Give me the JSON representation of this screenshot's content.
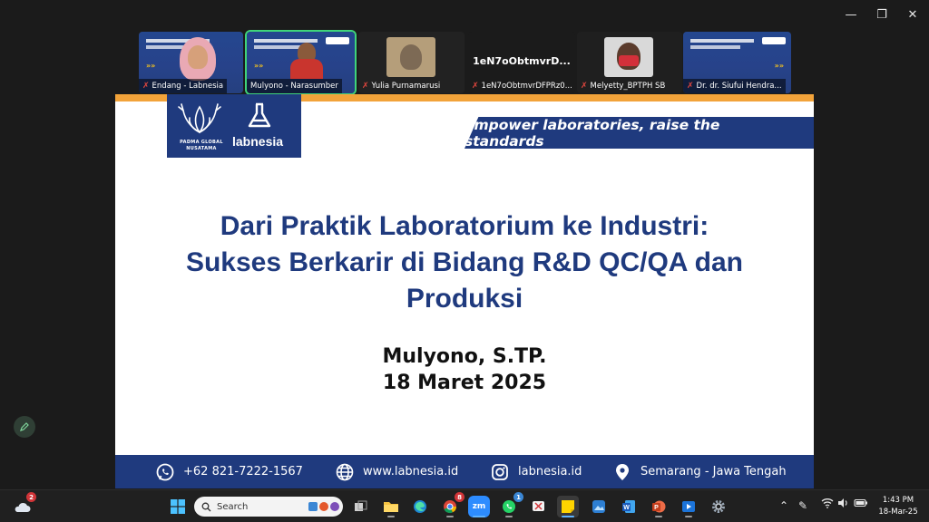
{
  "window": {
    "minimize_icon": "minimize-icon",
    "restore_icon": "restore-icon",
    "close_icon": "close-icon"
  },
  "participants": [
    {
      "name": "Endang - Labnesia",
      "muted": true
    },
    {
      "name": "Mulyono - Narasumber",
      "muted": false
    },
    {
      "name": "Yulia Purnamarusi",
      "muted": true
    },
    {
      "name": "1eN7oObtmvrDFPRz0...",
      "label": "1eN7oObtmvrD...",
      "muted": true
    },
    {
      "name": "Melyetty_BPTPH SB",
      "muted": true
    },
    {
      "name": "Dr. dr. Siufui Hendra...",
      "muted": true
    }
  ],
  "slide": {
    "brand_1": "PADMA GLOBAL NUSATAMA",
    "brand_2": "labnesia",
    "tagline": "empower laboratories, raise the standards",
    "title_line_1": "Dari Praktik Laboratorium ke Industri:",
    "title_line_2": "Sukses Berkarir di Bidang R&D QC/QA dan",
    "title_line_3": "Produksi",
    "presenter": "Mulyono, S.TP.",
    "date": "18 Maret 2025",
    "footer": {
      "phone": "+62 821-7222-1567",
      "website": "www.labnesia.id",
      "instagram": "labnesia.id",
      "location": "Semarang - Jawa Tengah"
    },
    "colors": {
      "navy": "#1f3a7e",
      "accent": "#f2a33a"
    }
  },
  "taskbar": {
    "weather_badge": "2",
    "search_placeholder": "Search",
    "chrome_badge": "8",
    "whatsapp_badge": "1",
    "zoom_label": "zm",
    "time": "1:43 PM",
    "date": "18-Mar-25"
  }
}
